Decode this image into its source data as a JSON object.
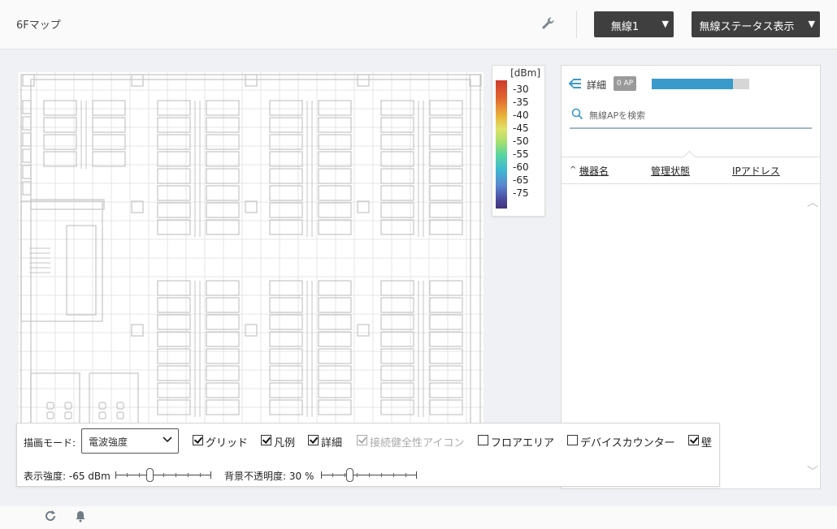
{
  "header": {
    "page_title": "6Fマップ",
    "wrench_icon": "wrench-icon",
    "wireless_dropdown": "無線1",
    "status_dropdown": "無線ステータス表示"
  },
  "map": {
    "floor_plan": "floor-plan-6f"
  },
  "legend": {
    "unit": "[dBm]",
    "ticks": [
      "-30",
      "-35",
      "-40",
      "-45",
      "-50",
      "-55",
      "-60",
      "-65",
      "-75"
    ],
    "gradient_colors": [
      "#cf3b2e",
      "#eab33a",
      "#a8df6e",
      "#3fb8d2",
      "#42337a"
    ]
  },
  "details": {
    "back_icon": "back-arrow-icon",
    "title": "詳細",
    "ap_badge": "0 AP",
    "progress_fraction": 0.83,
    "search_placeholder": "無線APを検索",
    "columns": [
      "機器名",
      "管理状態",
      "IPアドレス"
    ],
    "sort_indicator": "^"
  },
  "draw_panel": {
    "mode_label": "描画モード:",
    "mode_value": "電波強度",
    "checkboxes": [
      {
        "label": "グリッド",
        "checked": true,
        "disabled": false
      },
      {
        "label": "凡例",
        "checked": true,
        "disabled": false
      },
      {
        "label": "詳細",
        "checked": true,
        "disabled": false
      },
      {
        "label": "接続健全性アイコン",
        "checked": true,
        "disabled": true
      },
      {
        "label": "フロアエリア",
        "checked": false,
        "disabled": false
      },
      {
        "label": "デバイスカウンター",
        "checked": false,
        "disabled": false
      },
      {
        "label": "壁",
        "checked": true,
        "disabled": false
      }
    ],
    "strength_label": "表示強度: -65 dBm",
    "opacity_label": "背景不透明度: 30 %",
    "strength_fraction": 0.36,
    "opacity_fraction": 0.3
  },
  "footer": {
    "icons": [
      "refresh-icon",
      "bell-icon"
    ]
  },
  "colors": {
    "accent": "#3a9acb",
    "dropdown_bg": "#3f3f3f"
  }
}
